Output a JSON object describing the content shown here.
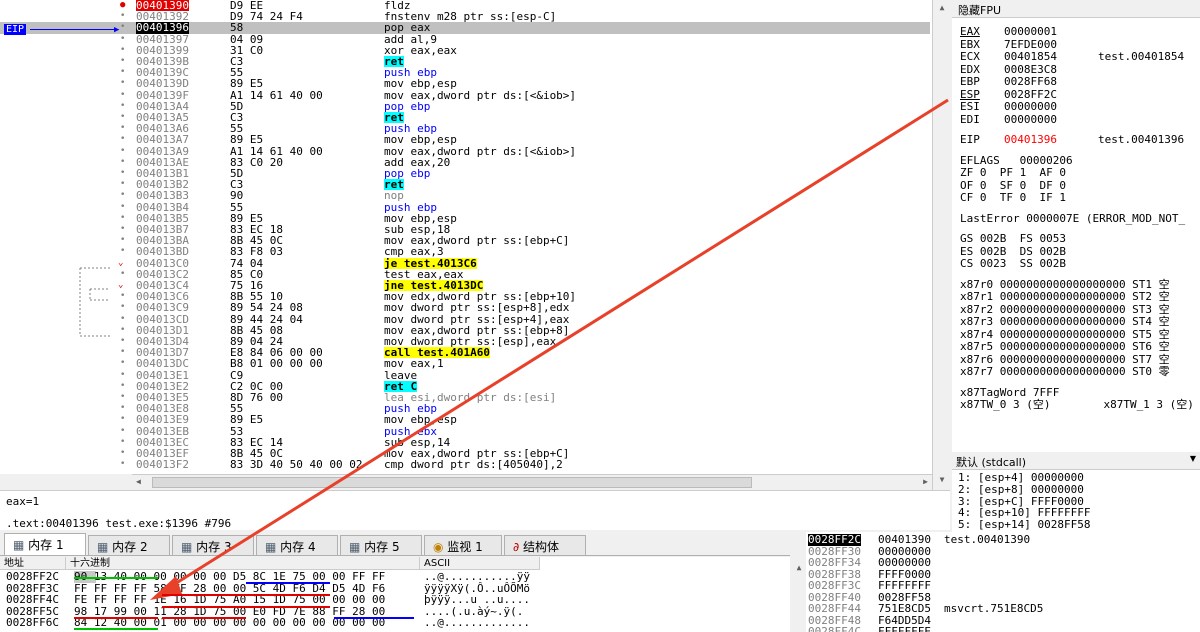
{
  "disasm": {
    "eip_label": "EIP",
    "rows": [
      {
        "addr": "00401390",
        "bytes": "D9 EE",
        "instr": "fldz",
        "marker": "bp"
      },
      {
        "addr": "00401392",
        "bytes": "D9 74 24 F4",
        "instr": "fnstenv m28 ptr ss:[esp-C]",
        "marker": "dot"
      },
      {
        "addr": "00401396",
        "bytes": "58",
        "instr": "pop eax",
        "marker": "dot",
        "current": true
      },
      {
        "addr": "00401397",
        "bytes": "04 09",
        "instr": "add al,9",
        "marker": "dot"
      },
      {
        "addr": "00401399",
        "bytes": "31 C0",
        "instr": "xor eax,eax",
        "marker": "dot"
      },
      {
        "addr": "0040139B",
        "bytes": "C3",
        "instr": "ret",
        "marker": "dot",
        "kind": "ret"
      },
      {
        "addr": "0040139C",
        "bytes": "55",
        "instr": "push ebp",
        "marker": "dot",
        "kind": "push"
      },
      {
        "addr": "0040139D",
        "bytes": "89 E5",
        "instr": "mov ebp,esp",
        "marker": "dot"
      },
      {
        "addr": "0040139F",
        "bytes": "A1 14 61 40 00",
        "instr": "mov eax,dword ptr ds:[<&iob>]",
        "marker": "dot"
      },
      {
        "addr": "004013A4",
        "bytes": "5D",
        "instr": "pop ebp",
        "marker": "dot",
        "kind": "push"
      },
      {
        "addr": "004013A5",
        "bytes": "C3",
        "instr": "ret",
        "marker": "dot",
        "kind": "ret"
      },
      {
        "addr": "004013A6",
        "bytes": "55",
        "instr": "push ebp",
        "marker": "dot",
        "kind": "push"
      },
      {
        "addr": "004013A7",
        "bytes": "89 E5",
        "instr": "mov ebp,esp",
        "marker": "dot"
      },
      {
        "addr": "004013A9",
        "bytes": "A1 14 61 40 00",
        "instr": "mov eax,dword ptr ds:[<&iob>]",
        "marker": "dot"
      },
      {
        "addr": "004013AE",
        "bytes": "83 C0 20",
        "instr": "add eax,20",
        "marker": "dot"
      },
      {
        "addr": "004013B1",
        "bytes": "5D",
        "instr": "pop ebp",
        "marker": "dot",
        "kind": "push"
      },
      {
        "addr": "004013B2",
        "bytes": "C3",
        "instr": "ret",
        "marker": "dot",
        "kind": "ret"
      },
      {
        "addr": "004013B3",
        "bytes": "90",
        "instr": "nop",
        "marker": "dot",
        "kind": "nop"
      },
      {
        "addr": "004013B4",
        "bytes": "55",
        "instr": "push ebp",
        "marker": "dot",
        "kind": "push"
      },
      {
        "addr": "004013B5",
        "bytes": "89 E5",
        "instr": "mov ebp,esp",
        "marker": "dot"
      },
      {
        "addr": "004013B7",
        "bytes": "83 EC 18",
        "instr": "sub esp,18",
        "marker": "dot"
      },
      {
        "addr": "004013BA",
        "bytes": "8B 45 0C",
        "instr": "mov eax,dword ptr ss:[ebp+C]",
        "marker": "dot"
      },
      {
        "addr": "004013BD",
        "bytes": "83 F8 03",
        "instr": "cmp eax,3",
        "marker": "dot"
      },
      {
        "addr": "004013C0",
        "bytes": "74 04",
        "instr": "je test.4013C6",
        "marker": "jv",
        "kind": "jmp"
      },
      {
        "addr": "004013C2",
        "bytes": "85 C0",
        "instr": "test eax,eax",
        "marker": "dot"
      },
      {
        "addr": "004013C4",
        "bytes": "75 16",
        "instr": "jne test.4013DC",
        "marker": "jv",
        "kind": "jmp"
      },
      {
        "addr": "004013C6",
        "bytes": "8B 55 10",
        "instr": "mov edx,dword ptr ss:[ebp+10]",
        "marker": "dot"
      },
      {
        "addr": "004013C9",
        "bytes": "89 54 24 08",
        "instr": "mov dword ptr ss:[esp+8],edx",
        "marker": "dot"
      },
      {
        "addr": "004013CD",
        "bytes": "89 44 24 04",
        "instr": "mov dword ptr ss:[esp+4],eax",
        "marker": "dot"
      },
      {
        "addr": "004013D1",
        "bytes": "8B 45 08",
        "instr": "mov eax,dword ptr ss:[ebp+8]",
        "marker": "dot"
      },
      {
        "addr": "004013D4",
        "bytes": "89 04 24",
        "instr": "mov dword ptr ss:[esp],eax",
        "marker": "dot"
      },
      {
        "addr": "004013D7",
        "bytes": "E8 84 06 00 00",
        "instr": "call test.401A60",
        "marker": "dot",
        "kind": "call"
      },
      {
        "addr": "004013DC",
        "bytes": "B8 01 00 00 00",
        "instr": "mov eax,1",
        "marker": "dot"
      },
      {
        "addr": "004013E1",
        "bytes": "C9",
        "instr": "leave",
        "marker": "dot"
      },
      {
        "addr": "004013E2",
        "bytes": "C2 0C 00",
        "instr": "ret C",
        "marker": "dot",
        "kind": "ret"
      },
      {
        "addr": "004013E5",
        "bytes": "8D 76 00",
        "instr": "lea esi,dword ptr ds:[esi]",
        "marker": "dot",
        "kind": "nop"
      },
      {
        "addr": "004013E8",
        "bytes": "55",
        "instr": "push ebp",
        "marker": "dot",
        "kind": "push"
      },
      {
        "addr": "004013E9",
        "bytes": "89 E5",
        "instr": "mov ebp,esp",
        "marker": "dot"
      },
      {
        "addr": "004013EB",
        "bytes": "53",
        "instr": "push ebx",
        "marker": "dot",
        "kind": "push"
      },
      {
        "addr": "004013EC",
        "bytes": "83 EC 14",
        "instr": "sub esp,14",
        "marker": "dot"
      },
      {
        "addr": "004013EF",
        "bytes": "8B 45 0C",
        "instr": "mov eax,dword ptr ss:[ebp+C]",
        "marker": "dot"
      },
      {
        "addr": "004013F2",
        "bytes": "83 3D 40 50 40 00 02",
        "instr": "cmp dword ptr ds:[405040],2",
        "marker": "dot"
      }
    ]
  },
  "registers": {
    "header": "隐藏FPU",
    "gp": [
      {
        "name": "EAX",
        "value": "00000001",
        "comment": ""
      },
      {
        "name": "EBX",
        "value": "7EFDE000",
        "comment": ""
      },
      {
        "name": "ECX",
        "value": "00401854",
        "comment": "test.00401854"
      },
      {
        "name": "EDX",
        "value": "0008E3C8",
        "comment": ""
      },
      {
        "name": "EBP",
        "value": "0028FF68",
        "comment": ""
      },
      {
        "name": "ESP",
        "value": "0028FF2C",
        "comment": ""
      },
      {
        "name": "ESI",
        "value": "00000000",
        "comment": ""
      },
      {
        "name": "EDI",
        "value": "00000000",
        "comment": ""
      }
    ],
    "eip": {
      "name": "EIP",
      "value": "00401396",
      "comment": "test.00401396"
    },
    "eflags": "EFLAGS   00000206",
    "flags": [
      "ZF 0  PF 1  AF 0",
      "OF 0  SF 0  DF 0",
      "CF 0  TF 0  IF 1"
    ],
    "lasterror": "LastError 0000007E (ERROR_MOD_NOT_",
    "segs": [
      "GS 002B  FS 0053",
      "ES 002B  DS 002B",
      "CS 0023  SS 002B"
    ],
    "fpu": [
      "x87r0 0000000000000000000 ST1 空",
      "x87r1 0000000000000000000 ST2 空",
      "x87r2 0000000000000000000 ST3 空",
      "x87r3 0000000000000000000 ST4 空",
      "x87r4 0000000000000000000 ST5 空",
      "x87r5 0000000000000000000 ST6 空",
      "x87r6 0000000000000000000 ST7 空",
      "x87r7 0000000000000000000 ST0 零"
    ],
    "tagword": "x87TagWord 7FFF",
    "tw": "x87TW_0 3 (空)        x87TW_1 3 (空)"
  },
  "args": {
    "header": "默认 (stdcall)",
    "rows": [
      "1: [esp+4] 00000000",
      "2: [esp+8] 00000000",
      "3: [esp+C] FFFF0000",
      "4: [esp+10] FFFFFFFF",
      "5: [esp+14] 0028FF58"
    ]
  },
  "info": {
    "line1": "eax=1",
    "line2": ".text:00401396 test.exe:$1396 #796"
  },
  "tabs": [
    "内存 1",
    "内存 2",
    "内存 3",
    "内存 4",
    "内存 5",
    "监视 1",
    "结构体"
  ],
  "dump": {
    "col_addr": "地址",
    "col_hex": "十六进制",
    "col_ascii": "ASCII",
    "rows": [
      {
        "addr": "0028FF2C",
        "hex": "90 13 40 00 00 00 00 00 D5 8C 1E 75 00 00 FF FF",
        "ascii": "..@...........ÿÿ"
      },
      {
        "addr": "0028FF3C",
        "hex": "FF FF FF FF 58 FF 28 00 00 5C 4D F6 D4 D5 4D F6",
        "ascii": "ÿÿÿÿXÿ(.Ô..uÔÕMö"
      },
      {
        "addr": "0028FF4C",
        "hex": "FE FF FF FF 1E 16 1D 75 A0 15 1D 75 00 00 00 00",
        "ascii": "þÿÿÿ...u ..u...."
      },
      {
        "addr": "0028FF5C",
        "hex": "98 17 99 00 11 28 1D 75 00 E0 FD 7E 88 FF 28 00",
        "ascii": "....(.u.àý~.ÿ(."
      },
      {
        "addr": "0028FF6C",
        "hex": "84 12 40 00 01 00 00 00 00 00 00 00 00 00 00 00",
        "ascii": "..@............."
      }
    ]
  },
  "stack": {
    "rows": [
      {
        "addr": "0028FF2C",
        "val": "00401390",
        "comment": "test.00401390",
        "sel": true
      },
      {
        "addr": "0028FF30",
        "val": "00000000",
        "comment": ""
      },
      {
        "addr": "0028FF34",
        "val": "00000000",
        "comment": ""
      },
      {
        "addr": "0028FF38",
        "val": "FFFF0000",
        "comment": ""
      },
      {
        "addr": "0028FF3C",
        "val": "FFFFFFFF",
        "comment": ""
      },
      {
        "addr": "0028FF40",
        "val": "0028FF58",
        "comment": ""
      },
      {
        "addr": "0028FF44",
        "val": "751E8CD5",
        "comment": "msvcrt.751E8CD5"
      },
      {
        "addr": "0028FF48",
        "val": "F64DD5D4",
        "comment": ""
      },
      {
        "addr": "0028FF4C",
        "val": "FFFFFFFE",
        "comment": ""
      }
    ]
  },
  "colors": {
    "annotation_arrow": "#e8412a",
    "eip_blue": "#0000ff",
    "breakpoint_red": "#e00000"
  }
}
